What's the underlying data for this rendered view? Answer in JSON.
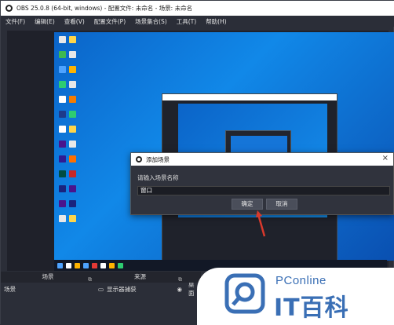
{
  "window": {
    "title": "OBS 25.0.8 (64-bit, windows) - 配置文件: 未命名 - 场景: 未命名"
  },
  "menu": [
    "文件(F)",
    "编辑(E)",
    "查看(V)",
    "配置文件(P)",
    "场景集合(S)",
    "工具(T)",
    "帮助(H)"
  ],
  "dialog": {
    "title": "添加场景",
    "close": "×",
    "label": "请输入场景名称",
    "input_value": "窗口",
    "ok": "确定",
    "cancel": "取消"
  },
  "panels": {
    "scenes_header": "场景",
    "scenes_item": "场景",
    "sources_header": "来源",
    "sources_item": "显示器捕获",
    "mixer_label": "桌面"
  },
  "brand": {
    "top": "PConline",
    "main": "IT百科"
  },
  "colors": {
    "accent": "#3a6fb5",
    "desktop": "#1188e8",
    "arrow": "#d8392c"
  }
}
